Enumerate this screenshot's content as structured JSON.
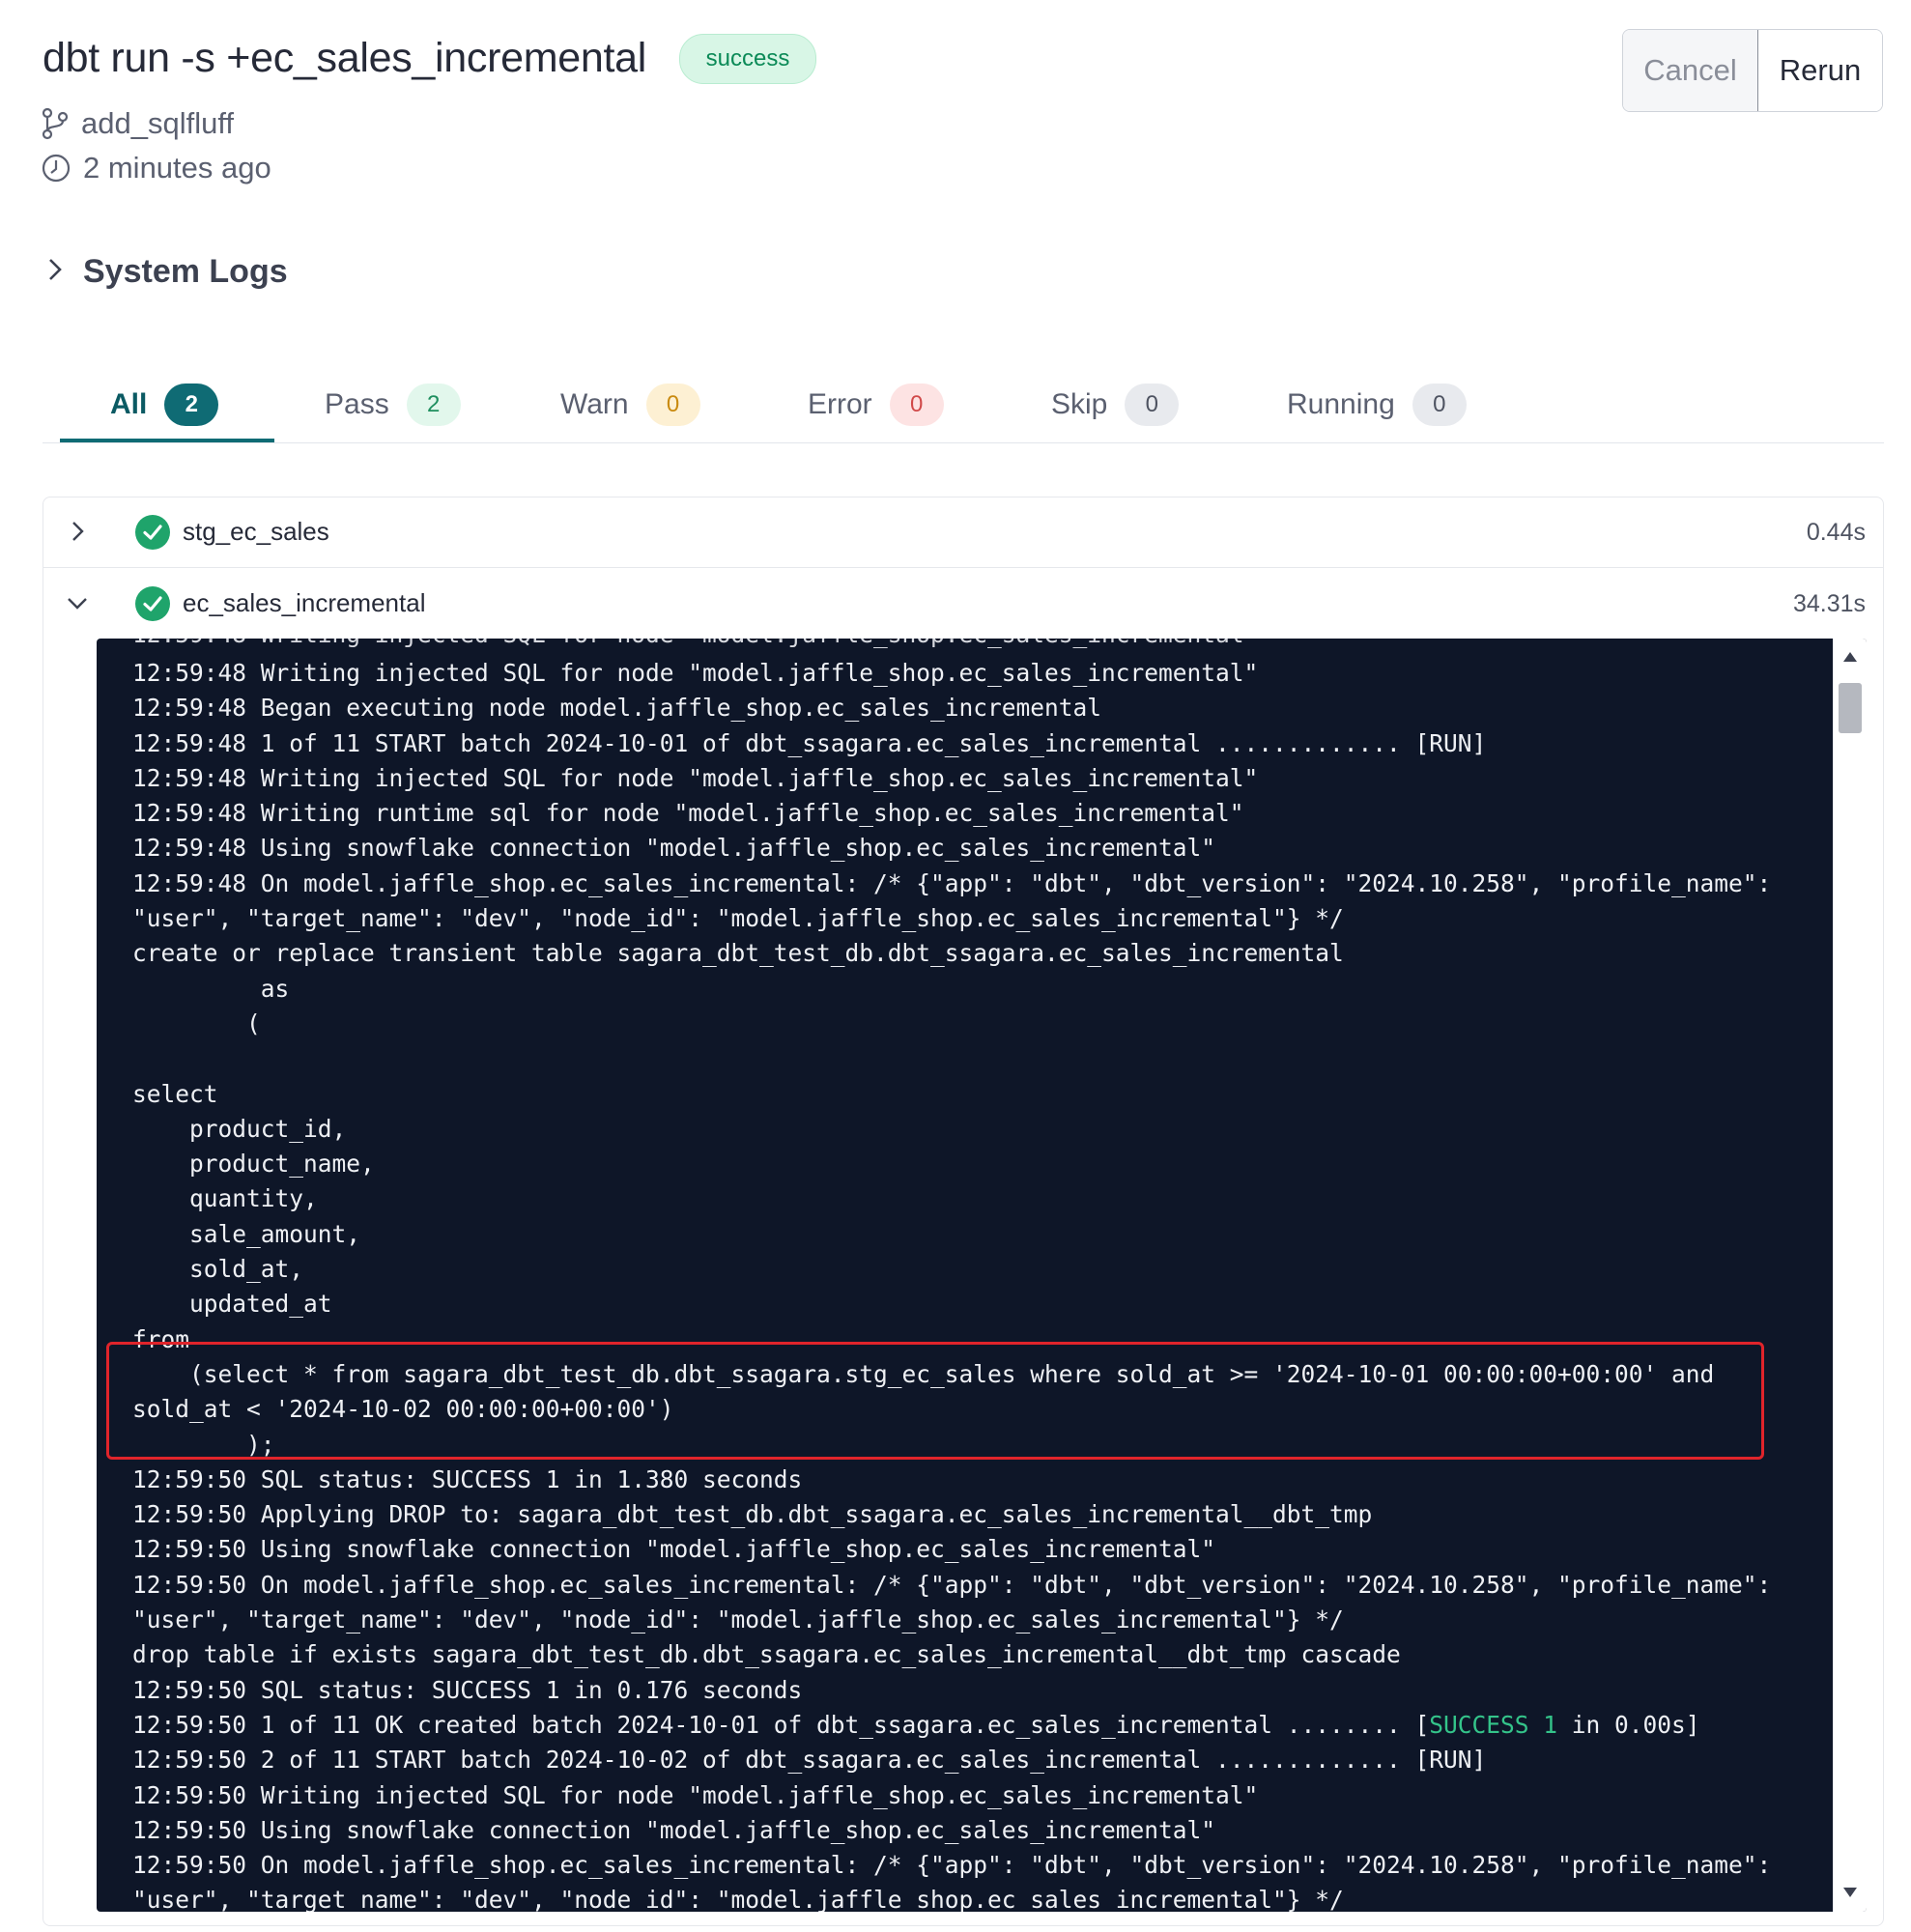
{
  "header": {
    "command": "dbt run -s +ec_sales_incremental",
    "status": "success",
    "branch": "add_sqlfluff",
    "time_ago": "2 minutes ago",
    "cancel_label": "Cancel",
    "rerun_label": "Rerun"
  },
  "system_logs_label": "System Logs",
  "tabs": [
    {
      "label": "All",
      "count": "2"
    },
    {
      "label": "Pass",
      "count": "2"
    },
    {
      "label": "Warn",
      "count": "0"
    },
    {
      "label": "Error",
      "count": "0"
    },
    {
      "label": "Skip",
      "count": "0"
    },
    {
      "label": "Running",
      "count": "0"
    }
  ],
  "nodes": [
    {
      "name": "stg_ec_sales",
      "duration": "0.44s",
      "expanded": false
    },
    {
      "name": "ec_sales_incremental",
      "duration": "34.31s",
      "expanded": true
    }
  ],
  "log_cutoff": "12:59:48 Writing injected SQL for node \"model.jaffle_shop.ec_sales_incremental\"",
  "log_lines": [
    "12:59:48 Writing injected SQL for node \"model.jaffle_shop.ec_sales_incremental\"",
    "12:59:48 Began executing node model.jaffle_shop.ec_sales_incremental",
    "12:59:48 1 of 11 START batch 2024-10-01 of dbt_ssagara.ec_sales_incremental ............. [RUN]",
    "12:59:48 Writing injected SQL for node \"model.jaffle_shop.ec_sales_incremental\"",
    "12:59:48 Writing runtime sql for node \"model.jaffle_shop.ec_sales_incremental\"",
    "12:59:48 Using snowflake connection \"model.jaffle_shop.ec_sales_incremental\"",
    "12:59:48 On model.jaffle_shop.ec_sales_incremental: /* {\"app\": \"dbt\", \"dbt_version\": \"2024.10.258\", \"profile_name\":",
    "\"user\", \"target_name\": \"dev\", \"node_id\": \"model.jaffle_shop.ec_sales_incremental\"} */",
    "create or replace transient table sagara_dbt_test_db.dbt_ssagara.ec_sales_incremental",
    "         as",
    "        (",
    "",
    "select",
    "    product_id,",
    "    product_name,",
    "    quantity,",
    "    sale_amount,",
    "    sold_at,",
    "    updated_at",
    "from",
    "    (select * from sagara_dbt_test_db.dbt_ssagara.stg_ec_sales where sold_at >= '2024-10-01 00:00:00+00:00' and",
    "sold_at < '2024-10-02 00:00:00+00:00')",
    "        );",
    "12:59:50 SQL status: SUCCESS 1 in 1.380 seconds",
    "12:59:50 Applying DROP to: sagara_dbt_test_db.dbt_ssagara.ec_sales_incremental__dbt_tmp",
    "12:59:50 Using snowflake connection \"model.jaffle_shop.ec_sales_incremental\"",
    "12:59:50 On model.jaffle_shop.ec_sales_incremental: /* {\"app\": \"dbt\", \"dbt_version\": \"2024.10.258\", \"profile_name\":",
    "\"user\", \"target_name\": \"dev\", \"node_id\": \"model.jaffle_shop.ec_sales_incremental\"} */",
    "drop table if exists sagara_dbt_test_db.dbt_ssagara.ec_sales_incremental__dbt_tmp cascade",
    "12:59:50 SQL status: SUCCESS 1 in 0.176 seconds",
    "12:59:50 1 of 11 OK created batch 2024-10-01 of dbt_ssagara.ec_sales_incremental ........ [SUCCESS 1 in 0.00s]",
    "12:59:50 2 of 11 START batch 2024-10-02 of dbt_ssagara.ec_sales_incremental ............. [RUN]",
    "12:59:50 Writing injected SQL for node \"model.jaffle_shop.ec_sales_incremental\"",
    "12:59:50 Using snowflake connection \"model.jaffle_shop.ec_sales_incremental\"",
    "12:59:50 On model.jaffle_shop.ec_sales_incremental: /* {\"app\": \"dbt\", \"dbt_version\": \"2024.10.258\", \"profile_name\":",
    "\"user\", \"target_name\": \"dev\", \"node_id\": \"model.jaffle_shop.ec_sales_incremental\"} */"
  ],
  "highlight_token": "SUCCESS 1",
  "colors": {
    "accent": "#0f6b74",
    "success": "#1fa46b",
    "highlight_box": "#e0242b",
    "log_bg": "#0e1628"
  }
}
